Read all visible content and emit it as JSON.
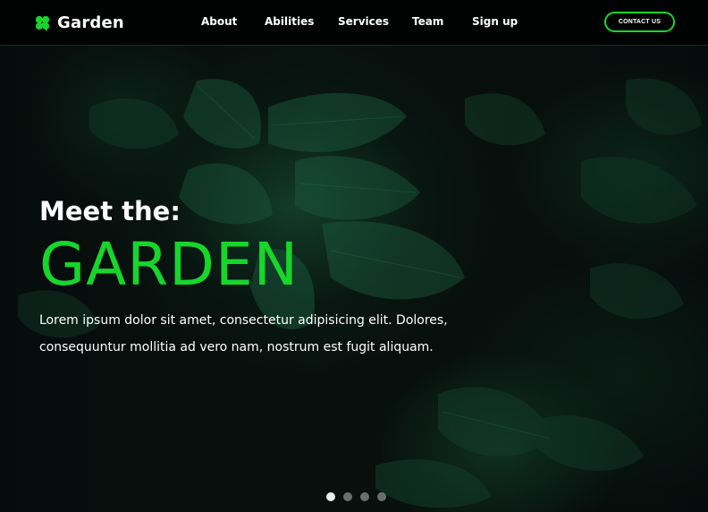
{
  "brand": {
    "name": "Garden",
    "icon": "clover-icon",
    "accent": "#17d62b"
  },
  "nav": {
    "items": [
      {
        "label": "About"
      },
      {
        "label": "Abilities"
      },
      {
        "label": "Services"
      },
      {
        "label": "Team"
      },
      {
        "label": "Sign up"
      }
    ],
    "cta_label": "CONTACT US"
  },
  "hero": {
    "kicker": "Meet the:",
    "title": "GARDEN",
    "description": "Lorem ipsum dolor sit amet, consectetur adipisicing elit. Dolores, consequuntur mollitia ad vero nam, nostrum est fugit aliquam.",
    "background": "dark-green-leaves-photo"
  },
  "carousel": {
    "slide_count": 4,
    "active_index": 0
  }
}
